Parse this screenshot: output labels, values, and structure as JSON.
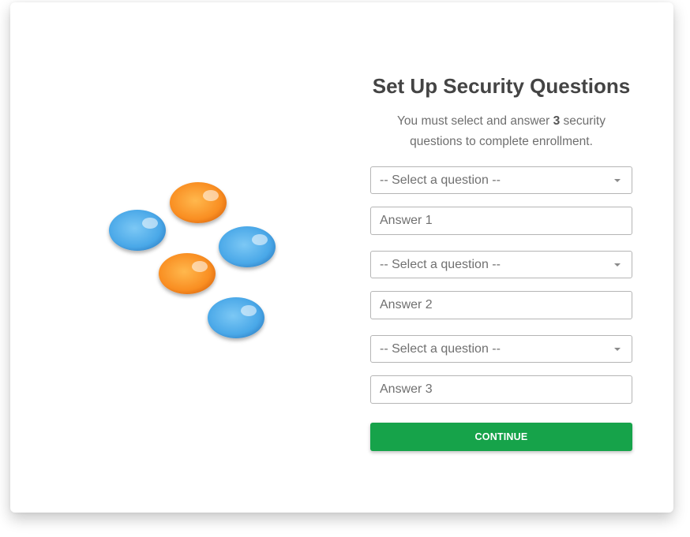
{
  "logo": {
    "icon": "colored-droplets-logo",
    "colors": {
      "blue": "#4aa8e8",
      "orange": "#f98e22"
    }
  },
  "header": {
    "title": "Set Up Security Questions",
    "subtitle_prefix": "You must select and answer ",
    "subtitle_count": "3",
    "subtitle_suffix": " security questions to complete enrollment."
  },
  "questions": [
    {
      "select_label": "-- Select a question --",
      "answer_placeholder": "Answer 1"
    },
    {
      "select_label": "-- Select a question --",
      "answer_placeholder": "Answer 2"
    },
    {
      "select_label": "-- Select a question --",
      "answer_placeholder": "Answer 3"
    }
  ],
  "continue_label": "CONTINUE",
  "colors": {
    "accent": "#16a34a",
    "title": "#444444",
    "muted": "#707070"
  }
}
